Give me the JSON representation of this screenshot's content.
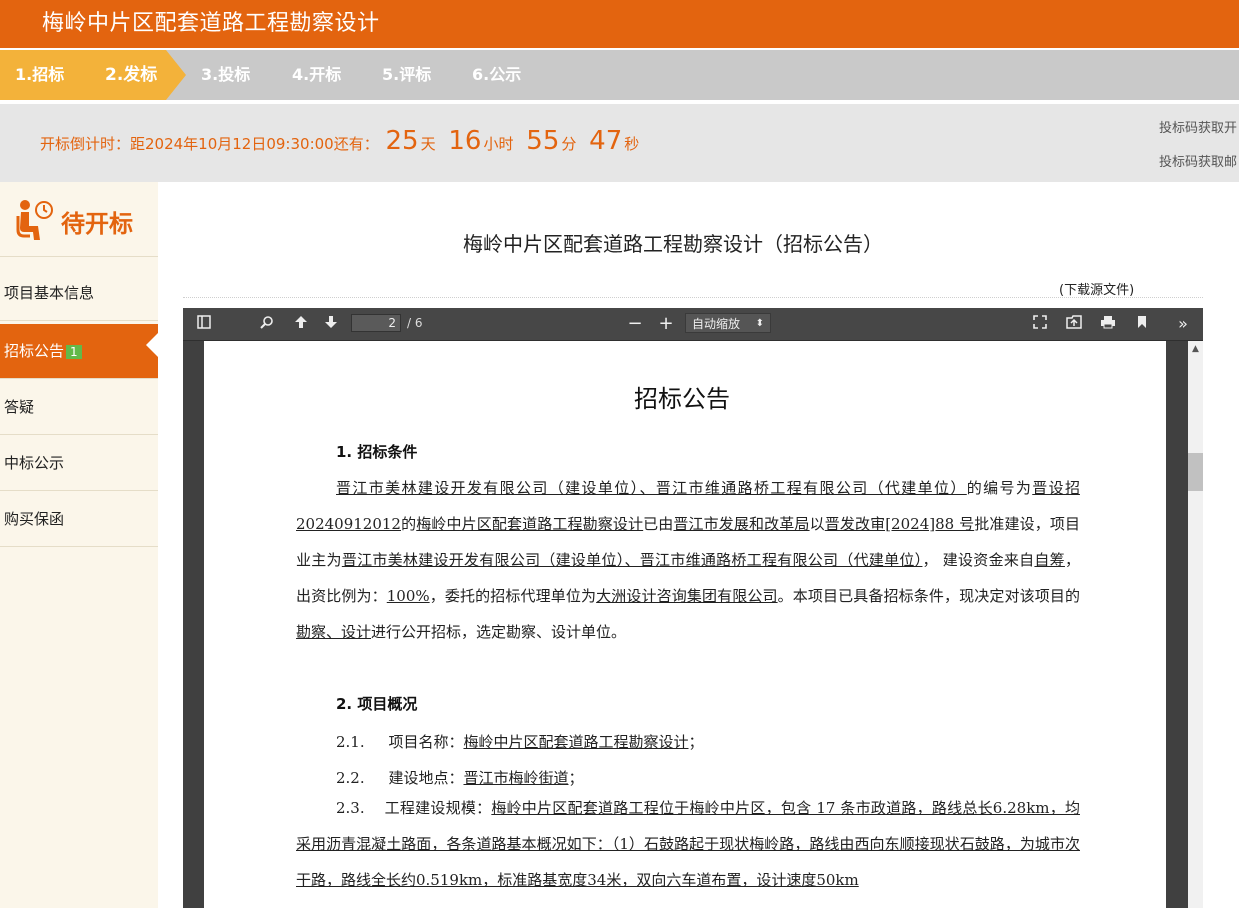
{
  "header": {
    "title": "梅岭中片区配套道路工程勘察设计"
  },
  "steps": [
    {
      "label": "1.招标"
    },
    {
      "label": "2.发标"
    },
    {
      "label": "3.投标"
    },
    {
      "label": "4.开标"
    },
    {
      "label": "5.评标"
    },
    {
      "label": "6.公示"
    }
  ],
  "countdown": {
    "prefix": "开标倒计时：距2024年10月12日09:30:00还有：",
    "days": "25",
    "days_unit": "天",
    "hours": "16",
    "hours_unit": "小时",
    "minutes": "55",
    "minutes_unit": "分",
    "seconds": "47",
    "seconds_unit": "秒",
    "right_line1": "投标码获取开",
    "right_line2": "投标码获取邮"
  },
  "sidebar": {
    "status": "待开标",
    "items": [
      {
        "label": "项目基本信息"
      },
      {
        "label": "招标公告",
        "badge": "1"
      },
      {
        "label": "答疑"
      },
      {
        "label": "中标公示"
      },
      {
        "label": "购买保函"
      }
    ]
  },
  "main": {
    "doc_title": "梅岭中片区配套道路工程勘察设计（招标公告）",
    "download_label": "(下载源文件)"
  },
  "viewer": {
    "page_current": "2",
    "page_total": "/ 6",
    "zoom": "自动缩放",
    "icons": [
      "sidebar-toggle-icon",
      "search-icon",
      "previous-page-icon",
      "next-page-icon",
      "zoom-out-icon",
      "zoom-in-icon",
      "presentation-icon",
      "open-file-icon",
      "print-icon",
      "bookmark-icon",
      "tools-icon"
    ]
  },
  "pdf": {
    "heading": "招标公告",
    "section1": "1. 招标条件",
    "p1": {
      "u1": "晋江市美林建设开发有限公司（建设单位）、晋江市维通路桥工程有限公司（代建单位）",
      "t1": "的编号为",
      "u2": "晋设招 20240912012",
      "t2": "的",
      "u3": "梅岭中片区配套道路工程勘察设计",
      "t3": "已由",
      "u4": "晋江市发展和改革局",
      "t4": "以",
      "u5": "晋发改审[2024]88 号",
      "t5": "批准建设，项目业主为",
      "u6": "晋江市美林建设开发有限公司（建设单位）、晋江市维通路桥工程有限公司（代建单位）",
      "t6": "， 建设资金来自",
      "u7": "自筹",
      "t7": "，出资比例为：",
      "u8": "100%",
      "t8": "，委托的招标代理单位为",
      "u9": "大洲设计咨询集团有限公司",
      "t9": "。本项目已具备招标条件，现决定对该项目的",
      "u10": "勘察、设计",
      "t10": "进行公开招标，选定勘察、设计单位。"
    },
    "section2": "2. 项目概况",
    "l21_num": "2.1.",
    "l21_label": "项目名称：",
    "l21_val": "梅岭中片区配套道路工程勘察设计",
    "l21_end": "；",
    "l22_num": "2.2.",
    "l22_label": "建设地点：",
    "l22_val": "晋江市梅岭街道",
    "l22_end": "；",
    "l23_num": "2.3.",
    "l23_label": "工程建设规模：",
    "l23_val": "梅岭中片区配套道路工程位于梅岭中片区，包含 17 条市政道路，路线总长6.28km，均采用沥青混凝土路面，各条道路基本概况如下：（1）石鼓路起于现状梅岭路，路线由西向东顺接现状石鼓路，为城市次干路，路线全长约0.519km，标准路基宽度34米，双向六车道布置，设计速度50km"
  }
}
